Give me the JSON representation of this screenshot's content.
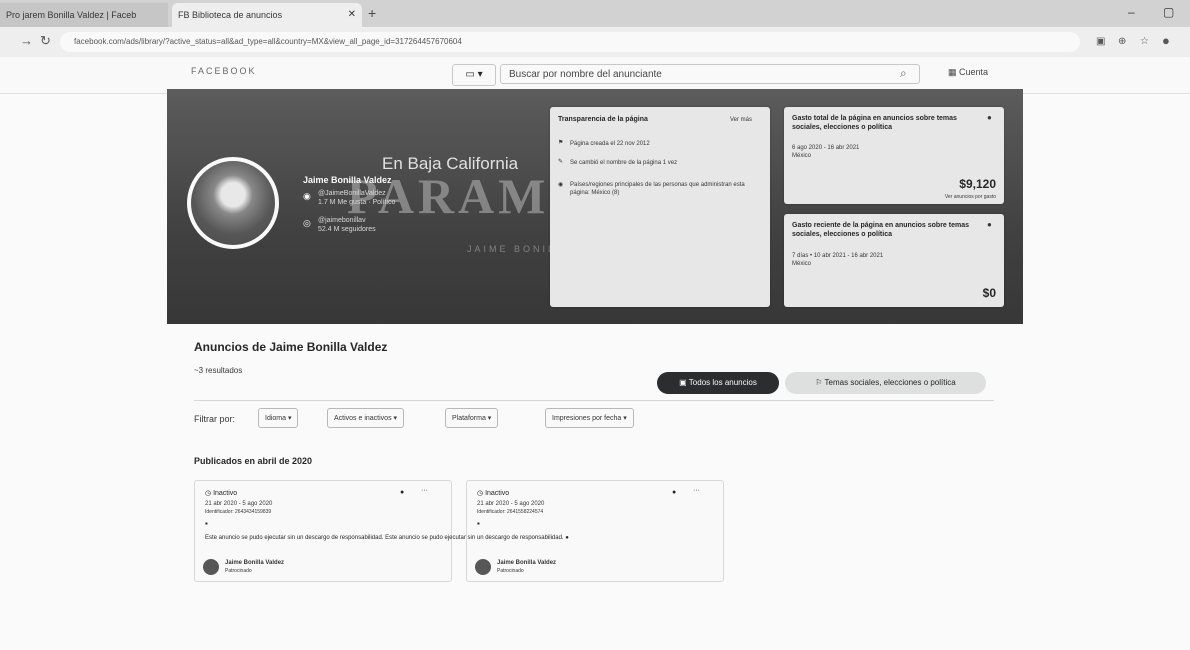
{
  "browser": {
    "tabs": [
      {
        "label": "Pro jarem Bonilla Valdez | Faceb"
      },
      {
        "label": "FB  Biblioteca de anuncios"
      }
    ],
    "url": "facebook.com/ads/library/?active_status=all&ad_type=all&country=MX&view_all_page_id=317264457670604"
  },
  "header": {
    "logo": "FACEBOOK",
    "search_placeholder": "Buscar por nombre del anunciante",
    "account_label": "Cuenta"
  },
  "banner": {
    "headline": "En Baja California",
    "big_text": "PARAMO",
    "footer_text": "JAIME BONILLA",
    "page_name": "Jaime Bonilla Valdez",
    "info_line1": "@JaimeBonillaValdez",
    "info_line2": "1.7 M Me gusta · Político",
    "info_line3": "@jaimebonillav",
    "info_line4": "52.4 M seguidores"
  },
  "transparency": {
    "title": "Transparencia de la página",
    "link": "Ver más",
    "created": "Página creada el 22 nov 2012",
    "renamed": "Se cambió el nombre de la página 1 vez",
    "location": "Países/regiones principales de las personas que administran esta página: México (8)"
  },
  "spend_total": {
    "title": "Gasto total de la página en anuncios sobre temas sociales, elecciones o política",
    "dates": "6 ago 2020 - 16 abr 2021",
    "location": "México",
    "amount": "$9,120",
    "note": "Ver anuncios por gasto"
  },
  "spend_recent": {
    "title": "Gasto reciente de la página en anuncios sobre temas sociales, elecciones o política",
    "dates": "7 días • 10 abr 2021 - 16 abr 2021",
    "location": "México",
    "amount": "$0"
  },
  "ads": {
    "title": "Anuncios de Jaime Bonilla Valdez",
    "results": "~3 resultados",
    "all_ads_button": "Todos los anuncios",
    "social_button": "Temas sociales, elecciones o política",
    "filter_label": "Filtrar por:",
    "filters": [
      "Idioma",
      "Activos e inactivos",
      "Plataforma",
      "Impresiones por fecha"
    ],
    "published_heading": "Publicados en abril de 2020",
    "cards": [
      {
        "status": "Inactivo",
        "dates": "21 abr 2020 - 5 ago 2020",
        "id": "Identificador: 2643434159839",
        "advertiser": "Jaime Bonilla Valdez",
        "sponsor": "Patrocinado"
      },
      {
        "status": "Inactivo",
        "dates": "21 abr 2020 - 5 ago 2020",
        "id": "Identificador: 2641558224574",
        "advertiser": "Jaime Bonilla Valdez",
        "sponsor": "Patrocinado"
      }
    ],
    "disclaimer_a": "Este anuncio se pudo ejecutar sin un descargo de responsabilidad.",
    "disclaimer_b": "Este anuncio se pudo ejecutar sin un descargo de responsabilidad."
  }
}
